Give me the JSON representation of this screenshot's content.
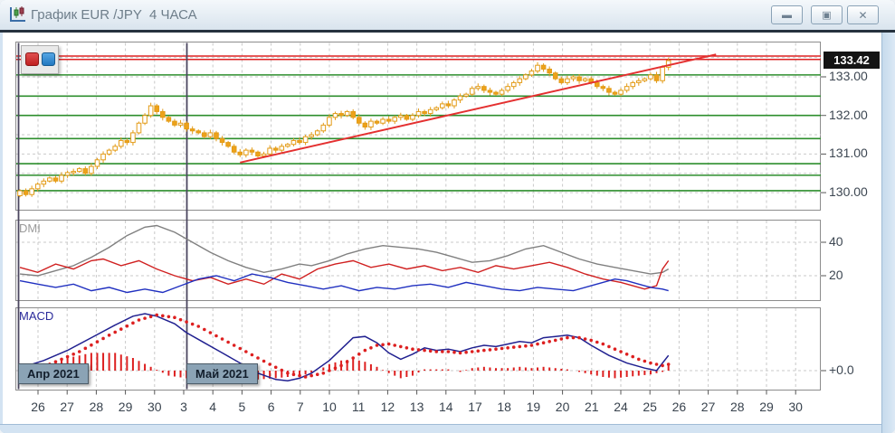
{
  "window": {
    "title": "График EUR /JPY  4 ЧАСА",
    "buttons": {
      "minimize": "▬",
      "maximize": "▣",
      "close": "✕"
    }
  },
  "toolbar": {
    "red_button": "series-style-red",
    "blue_button": "series-style-blue"
  },
  "panels": {
    "dmi_label": "DMI",
    "macd_label": "MACD"
  },
  "months": {
    "april": "Апр 2021",
    "may": "Май 2021"
  },
  "current_price": "133.42",
  "chart_data": {
    "type": "candlestick",
    "symbol": "EUR/JPY",
    "timeframe": "4 ЧАСА",
    "x_labels": [
      "26",
      "27",
      "28",
      "29",
      "30",
      "3",
      "4",
      "5",
      "6",
      "7",
      "10",
      "11",
      "12",
      "13",
      "14",
      "17",
      "18",
      "19",
      "20",
      "21",
      "24",
      "25",
      "26",
      "27",
      "28",
      "29",
      "30"
    ],
    "month_breaks": {
      "april_x_index": 0,
      "may_x_index": 5
    },
    "price_axis": {
      "ticks": [
        133.0,
        132.0,
        131.0,
        130.0
      ],
      "ylim": [
        129.8,
        133.8
      ],
      "last_price": 133.42
    },
    "open_first": 129.92,
    "closes": [
      130.05,
      129.95,
      130.1,
      130.22,
      130.3,
      130.38,
      130.3,
      130.45,
      130.52,
      130.55,
      130.62,
      130.5,
      130.68,
      130.85,
      131.0,
      131.1,
      131.2,
      131.35,
      131.3,
      131.55,
      131.8,
      132.0,
      132.25,
      132.1,
      131.95,
      131.85,
      131.75,
      131.8,
      131.65,
      131.6,
      131.55,
      131.45,
      131.55,
      131.4,
      131.3,
      131.2,
      131.05,
      130.98,
      131.1,
      131.05,
      130.95,
      131.0,
      131.15,
      131.1,
      131.2,
      131.25,
      131.35,
      131.3,
      131.45,
      131.5,
      131.6,
      131.75,
      131.95,
      132.05,
      132.0,
      132.1,
      131.95,
      131.8,
      131.7,
      131.85,
      131.8,
      131.9,
      131.85,
      131.95,
      132.0,
      131.9,
      132.0,
      132.1,
      132.05,
      132.15,
      132.2,
      132.3,
      132.25,
      132.4,
      132.5,
      132.55,
      132.7,
      132.75,
      132.65,
      132.6,
      132.55,
      132.65,
      132.75,
      132.85,
      132.95,
      133.05,
      133.15,
      133.3,
      133.2,
      133.1,
      132.95,
      132.85,
      132.95,
      133.0,
      132.9,
      132.95,
      132.85,
      132.75,
      132.7,
      132.6,
      132.55,
      132.65,
      132.75,
      132.85,
      132.9,
      132.95,
      133.05,
      132.9,
      133.25,
      133.42
    ],
    "green_levels": [
      133.05,
      132.5,
      132.0,
      131.4,
      130.75,
      130.45,
      130.05
    ],
    "red_levels": [
      133.54,
      133.45
    ],
    "dashed_levels": [
      133.5,
      133.0,
      132.5,
      132.0,
      131.5,
      131.0,
      130.5,
      130.0
    ],
    "trendline": {
      "idx1": 37,
      "price1": 130.78,
      "idx2": 117,
      "price2": 133.58
    },
    "dmi": {
      "ticks": [
        40,
        20
      ],
      "adx": [
        [
          0,
          21
        ],
        [
          3,
          20
        ],
        [
          6,
          23
        ],
        [
          9,
          26
        ],
        [
          12,
          31
        ],
        [
          15,
          37
        ],
        [
          18,
          44
        ],
        [
          21,
          49
        ],
        [
          23,
          50
        ],
        [
          26,
          46
        ],
        [
          29,
          40
        ],
        [
          32,
          34
        ],
        [
          35,
          29
        ],
        [
          38,
          25
        ],
        [
          41,
          22
        ],
        [
          44,
          24
        ],
        [
          47,
          27
        ],
        [
          49,
          26
        ],
        [
          52,
          29
        ],
        [
          55,
          33
        ],
        [
          58,
          36
        ],
        [
          61,
          38
        ],
        [
          64,
          37
        ],
        [
          67,
          36
        ],
        [
          70,
          34
        ],
        [
          73,
          31
        ],
        [
          76,
          28
        ],
        [
          79,
          29
        ],
        [
          82,
          32
        ],
        [
          85,
          36
        ],
        [
          88,
          38
        ],
        [
          91,
          34
        ],
        [
          94,
          30
        ],
        [
          97,
          27
        ],
        [
          100,
          25
        ],
        [
          103,
          23
        ],
        [
          106,
          21
        ],
        [
          108,
          22
        ],
        [
          109,
          24
        ]
      ],
      "plus_di": [
        [
          0,
          25
        ],
        [
          3,
          22
        ],
        [
          6,
          27
        ],
        [
          9,
          24
        ],
        [
          12,
          29
        ],
        [
          14,
          30
        ],
        [
          17,
          26
        ],
        [
          20,
          29
        ],
        [
          23,
          24
        ],
        [
          26,
          20
        ],
        [
          29,
          17
        ],
        [
          32,
          19
        ],
        [
          35,
          15
        ],
        [
          38,
          18
        ],
        [
          41,
          15
        ],
        [
          44,
          21
        ],
        [
          47,
          18
        ],
        [
          50,
          24
        ],
        [
          53,
          27
        ],
        [
          56,
          29
        ],
        [
          59,
          25
        ],
        [
          62,
          27
        ],
        [
          65,
          24
        ],
        [
          68,
          26
        ],
        [
          71,
          23
        ],
        [
          74,
          25
        ],
        [
          77,
          22
        ],
        [
          80,
          26
        ],
        [
          83,
          24
        ],
        [
          86,
          26
        ],
        [
          89,
          28
        ],
        [
          92,
          25
        ],
        [
          95,
          21
        ],
        [
          98,
          18
        ],
        [
          101,
          16
        ],
        [
          103,
          14
        ],
        [
          105,
          12
        ],
        [
          107,
          14
        ],
        [
          108,
          24
        ],
        [
          109,
          29
        ]
      ],
      "minus_di": [
        [
          0,
          17
        ],
        [
          3,
          15
        ],
        [
          6,
          13
        ],
        [
          9,
          15
        ],
        [
          12,
          11
        ],
        [
          15,
          13
        ],
        [
          18,
          10
        ],
        [
          21,
          12
        ],
        [
          24,
          10
        ],
        [
          27,
          14
        ],
        [
          30,
          18
        ],
        [
          33,
          20
        ],
        [
          36,
          17
        ],
        [
          39,
          21
        ],
        [
          42,
          19
        ],
        [
          45,
          16
        ],
        [
          48,
          14
        ],
        [
          51,
          12
        ],
        [
          54,
          14
        ],
        [
          57,
          11
        ],
        [
          60,
          13
        ],
        [
          63,
          12
        ],
        [
          66,
          14
        ],
        [
          69,
          15
        ],
        [
          72,
          13
        ],
        [
          75,
          16
        ],
        [
          78,
          14
        ],
        [
          81,
          12
        ],
        [
          84,
          11
        ],
        [
          87,
          13
        ],
        [
          90,
          12
        ],
        [
          93,
          11
        ],
        [
          96,
          14
        ],
        [
          99,
          17
        ],
        [
          100,
          18
        ],
        [
          102,
          17
        ],
        [
          104,
          15
        ],
        [
          106,
          13
        ],
        [
          108,
          12
        ],
        [
          109,
          11
        ]
      ]
    },
    "macd": {
      "zero_label": "+0.0",
      "macd_line": [
        [
          0,
          0.02
        ],
        [
          4,
          0.08
        ],
        [
          8,
          0.16
        ],
        [
          12,
          0.26
        ],
        [
          16,
          0.36
        ],
        [
          19,
          0.43
        ],
        [
          21,
          0.45
        ],
        [
          23,
          0.43
        ],
        [
          26,
          0.37
        ],
        [
          28,
          0.3
        ],
        [
          31,
          0.22
        ],
        [
          34,
          0.14
        ],
        [
          37,
          0.06
        ],
        [
          40,
          -0.02
        ],
        [
          43,
          -0.07
        ],
        [
          45,
          -0.08
        ],
        [
          47,
          -0.06
        ],
        [
          49,
          -0.02
        ],
        [
          52,
          0.08
        ],
        [
          54,
          0.17
        ],
        [
          56,
          0.26
        ],
        [
          58,
          0.27
        ],
        [
          60,
          0.22
        ],
        [
          62,
          0.14
        ],
        [
          64,
          0.09
        ],
        [
          66,
          0.13
        ],
        [
          68,
          0.18
        ],
        [
          70,
          0.16
        ],
        [
          72,
          0.17
        ],
        [
          74,
          0.15
        ],
        [
          76,
          0.18
        ],
        [
          78,
          0.2
        ],
        [
          80,
          0.19
        ],
        [
          82,
          0.21
        ],
        [
          84,
          0.23
        ],
        [
          86,
          0.22
        ],
        [
          88,
          0.26
        ],
        [
          90,
          0.27
        ],
        [
          92,
          0.28
        ],
        [
          94,
          0.26
        ],
        [
          96,
          0.2
        ],
        [
          99,
          0.12
        ],
        [
          102,
          0.06
        ],
        [
          105,
          0.02
        ],
        [
          107,
          0.0
        ],
        [
          109,
          0.12
        ]
      ],
      "signal_line": [
        [
          0,
          0.0
        ],
        [
          5,
          0.05
        ],
        [
          10,
          0.15
        ],
        [
          15,
          0.28
        ],
        [
          20,
          0.4
        ],
        [
          23,
          0.44
        ],
        [
          26,
          0.42
        ],
        [
          30,
          0.35
        ],
        [
          34,
          0.25
        ],
        [
          38,
          0.15
        ],
        [
          42,
          0.05
        ],
        [
          45,
          -0.02
        ],
        [
          48,
          -0.05
        ],
        [
          51,
          -0.02
        ],
        [
          54,
          0.04
        ],
        [
          56,
          0.1
        ],
        [
          58,
          0.16
        ],
        [
          60,
          0.2
        ],
        [
          62,
          0.21
        ],
        [
          64,
          0.19
        ],
        [
          66,
          0.17
        ],
        [
          68,
          0.16
        ],
        [
          70,
          0.15
        ],
        [
          72,
          0.15
        ],
        [
          74,
          0.14
        ],
        [
          76,
          0.15
        ],
        [
          78,
          0.16
        ],
        [
          80,
          0.17
        ],
        [
          82,
          0.18
        ],
        [
          84,
          0.19
        ],
        [
          86,
          0.2
        ],
        [
          88,
          0.22
        ],
        [
          90,
          0.24
        ],
        [
          92,
          0.26
        ],
        [
          94,
          0.26
        ],
        [
          96,
          0.24
        ],
        [
          98,
          0.21
        ],
        [
          100,
          0.17
        ],
        [
          102,
          0.13
        ],
        [
          104,
          0.09
        ],
        [
          106,
          0.06
        ],
        [
          108,
          0.04
        ],
        [
          109,
          0.05
        ]
      ],
      "histogram": [
        [
          0,
          0.01
        ],
        [
          4,
          0.05
        ],
        [
          8,
          0.1
        ],
        [
          12,
          0.14
        ],
        [
          16,
          0.14
        ],
        [
          19,
          0.1
        ],
        [
          22,
          0.03
        ],
        [
          25,
          -0.04
        ],
        [
          28,
          -0.06
        ],
        [
          31,
          -0.08
        ],
        [
          34,
          -0.09
        ],
        [
          37,
          -0.08
        ],
        [
          40,
          -0.07
        ],
        [
          43,
          -0.06
        ],
        [
          45,
          -0.05
        ],
        [
          48,
          -0.03
        ],
        [
          50,
          0.0
        ],
        [
          52,
          0.05
        ],
        [
          54,
          0.08
        ],
        [
          56,
          0.09
        ],
        [
          58,
          0.07
        ],
        [
          60,
          0.03
        ],
        [
          62,
          -0.02
        ],
        [
          64,
          -0.06
        ],
        [
          66,
          -0.04
        ],
        [
          68,
          0.01
        ],
        [
          70,
          0.01
        ],
        [
          72,
          0.01
        ],
        [
          74,
          -0.01
        ],
        [
          76,
          0.02
        ],
        [
          78,
          0.03
        ],
        [
          80,
          0.02
        ],
        [
          82,
          0.02
        ],
        [
          84,
          0.03
        ],
        [
          86,
          0.02
        ],
        [
          88,
          0.03
        ],
        [
          90,
          0.02
        ],
        [
          92,
          0.01
        ],
        [
          94,
          -0.01
        ],
        [
          96,
          -0.03
        ],
        [
          98,
          -0.05
        ],
        [
          100,
          -0.06
        ],
        [
          102,
          -0.05
        ],
        [
          104,
          -0.04
        ],
        [
          106,
          -0.03
        ],
        [
          108,
          -0.01
        ],
        [
          109,
          0.04
        ]
      ]
    },
    "colors": {
      "candle": "#e39b16",
      "candle_up_fill": "#ffffff",
      "candle_down_fill": "#eda21a",
      "green_level": "#2d8e2d",
      "red_level": "#dd2222",
      "trendline": "#e43030",
      "grid": "#c9c9c9",
      "month_separator": "#4b465f",
      "adx": "#808080",
      "plus_di": "#d02020",
      "minus_di": "#2030c0",
      "macd": "#202090",
      "signal": "#dd2020",
      "histogram": "#dd2020"
    }
  }
}
